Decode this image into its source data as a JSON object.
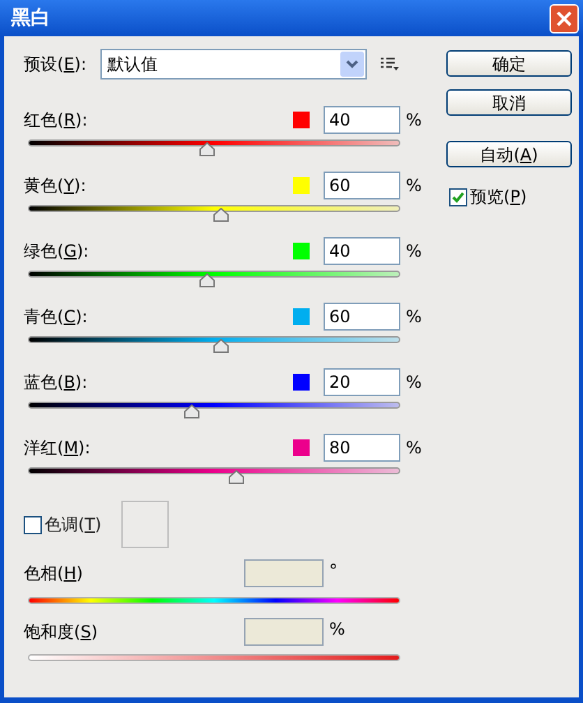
{
  "window": {
    "title": "黑白"
  },
  "preset": {
    "label": {
      "before": "预设(",
      "key": "E",
      "after": "):"
    },
    "value": "默认值"
  },
  "channels": [
    {
      "label": {
        "before": "红色(",
        "key": "R",
        "after": "):"
      },
      "color": "#ff0000",
      "value": "40",
      "unit": "%",
      "level": 0.48
    },
    {
      "label": {
        "before": "黄色(",
        "key": "Y",
        "after": "):"
      },
      "color": "#ffff00",
      "value": "60",
      "unit": "%",
      "level": 0.52
    },
    {
      "label": {
        "before": "绿色(",
        "key": "G",
        "after": "):"
      },
      "color": "#00ff00",
      "value": "40",
      "unit": "%",
      "level": 0.48
    },
    {
      "label": {
        "before": "青色(",
        "key": "C",
        "after": "):"
      },
      "color": "#00aeef",
      "value": "60",
      "unit": "%",
      "level": 0.52
    },
    {
      "label": {
        "before": "蓝色(",
        "key": "B",
        "after": "):"
      },
      "color": "#0000ff",
      "value": "20",
      "unit": "%",
      "level": 0.44
    },
    {
      "label": {
        "before": "洋红(",
        "key": "M",
        "after": "):"
      },
      "color": "#ec008c",
      "value": "80",
      "unit": "%",
      "level": 0.56
    }
  ],
  "tint": {
    "label": {
      "before": "色调(",
      "key": "T",
      "after": ")"
    },
    "checked": false
  },
  "tint_sliders": [
    {
      "kind": "hue",
      "label": {
        "before": "色相(",
        "key": "H",
        "after": ")"
      },
      "unit": "°"
    },
    {
      "kind": "saturation",
      "label": {
        "before": "饱和度(",
        "key": "S",
        "after": ")"
      },
      "unit": "%"
    }
  ],
  "buttons": [
    {
      "label": {
        "before": "确定"
      }
    },
    {
      "label": {
        "before": "取消"
      }
    },
    {
      "label": {
        "before": "自动(",
        "key": "A",
        "after": ")"
      }
    }
  ],
  "preview": {
    "label": {
      "before": "预览(",
      "key": "P",
      "after": ")"
    },
    "checked": true
  }
}
